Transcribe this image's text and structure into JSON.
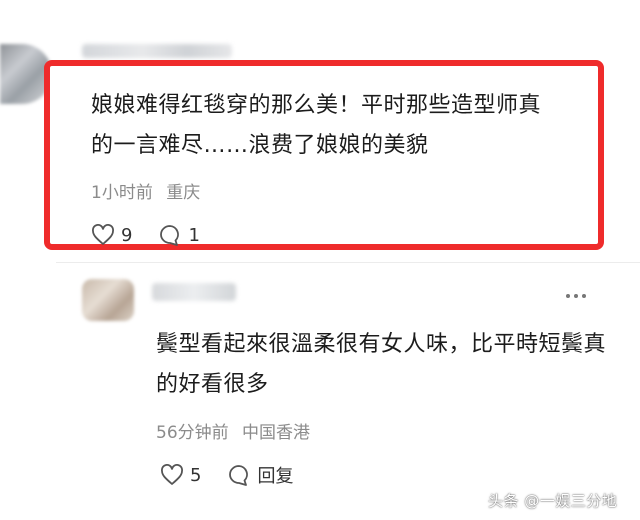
{
  "comment": {
    "text": "娘娘难得红毯穿的那么美！平时那些造型师真的一言难尽……浪费了娘娘的美貌",
    "time": "1小时前",
    "location": "重庆",
    "likes": "9",
    "replies": "1",
    "highlight_color": "#ef2b2b"
  },
  "reply": {
    "text": "鬓型看起來很溫柔很有女人味，比平時短鬓真的好看很多",
    "time": "56分钟前",
    "location": "中国香港",
    "likes": "5",
    "reply_label": "回复"
  },
  "watermark": "头条 @一娱三分地",
  "icons": {
    "like": "heart-icon",
    "comment": "comment-bubble-icon",
    "more": "more-dots-icon"
  }
}
